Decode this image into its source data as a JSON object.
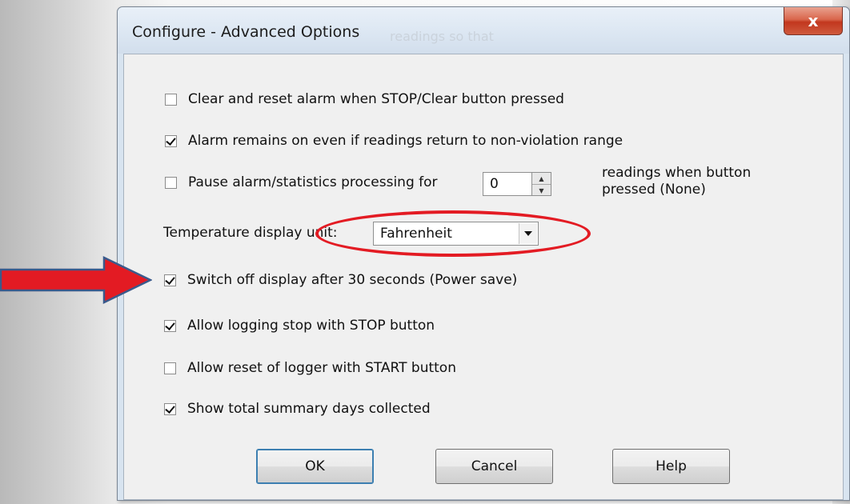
{
  "window": {
    "title": "Configure  - Advanced Options",
    "background_text": "readings so that",
    "close_glyph": "x"
  },
  "options": [
    {
      "label": "Clear and reset alarm when STOP/Clear button pressed",
      "checked": false
    },
    {
      "label": "Alarm remains on even if readings return to non-violation range",
      "checked": true
    },
    {
      "label": "Pause alarm/statistics processing for",
      "checked": false
    },
    {
      "label": "Switch off display after 30 seconds (Power save)",
      "checked": true
    },
    {
      "label": "Allow logging stop with STOP button",
      "checked": true
    },
    {
      "label": "Allow reset of logger with START button",
      "checked": false
    },
    {
      "label": "Show total summary days collected",
      "checked": true
    }
  ],
  "pause": {
    "value": "0",
    "note_line1": "readings when button",
    "note_line2": "pressed (None)"
  },
  "temperature": {
    "label": "Temperature display unit:",
    "selected": "Fahrenheit"
  },
  "buttons": {
    "ok": "OK",
    "cancel": "Cancel",
    "help": "Help"
  },
  "annotations": {
    "ellipse_color": "#e31b23",
    "arrow_color": "#e31b23",
    "arrow_outline": "#3a5a8c"
  },
  "colors": {
    "close_button": "#c2371e",
    "dialog_frame": "#d8e4f0",
    "client_bg": "#f0f0f0"
  },
  "icons": {
    "spin_up": "spin-up-arrow",
    "spin_down": "spin-down-arrow",
    "dropdown": "chevron-down-icon",
    "close": "close-icon"
  }
}
